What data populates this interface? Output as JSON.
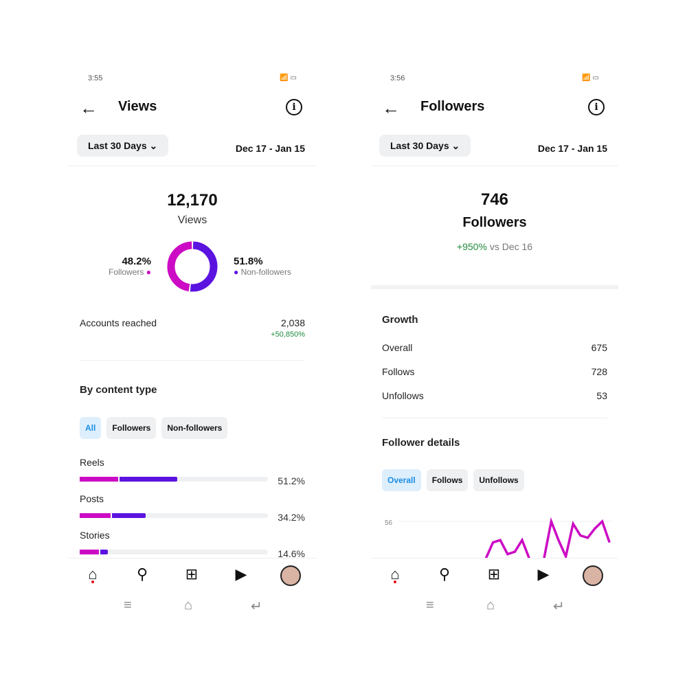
{
  "left": {
    "status_time": "3:55",
    "title": "Views",
    "range": "Last 30 Days",
    "dates": "Dec 17 - Jan 15",
    "total": "12,170",
    "total_label": "Views",
    "followers_pct": "48.2%",
    "followers_label": "Followers",
    "followers_value": 48.2,
    "nonfollowers_pct": "51.8%",
    "nonfollowers_label": "Non-followers",
    "nonfollowers_value": 51.8,
    "accounts_label": "Accounts reached",
    "accounts_value": "2,038",
    "accounts_change": "+50,850%",
    "section": "By content type",
    "filters": [
      "All",
      "Followers",
      "Non-followers"
    ],
    "content": [
      {
        "label": "Reels",
        "pct": "51.2%",
        "followers": 0.21,
        "total": 0.52
      },
      {
        "label": "Posts",
        "pct": "34.2%",
        "followers": 0.17,
        "total": 0.35
      },
      {
        "label": "Stories",
        "pct": "14.6%",
        "followers": 0.11,
        "total": 0.15
      }
    ]
  },
  "right": {
    "status_time": "3:56",
    "title": "Followers",
    "range": "Last 30 Days",
    "dates": "Dec 17 - Jan 15",
    "total": "746",
    "total_label": "Followers",
    "change": "+950%",
    "change_suffix": "vs Dec 16",
    "growth_title": "Growth",
    "growth": [
      {
        "label": "Overall",
        "value": "675"
      },
      {
        "label": "Follows",
        "value": "728"
      },
      {
        "label": "Unfollows",
        "value": "53"
      }
    ],
    "details_title": "Follower details",
    "filters": [
      "Overall",
      "Follows",
      "Unfollows"
    ]
  },
  "colors": {
    "followers": "#cc0bc4",
    "nonfollowers": "#5b13e0",
    "positive": "#1e8a3c",
    "accent": "#1a8fe3"
  },
  "chart_data": {
    "type": "line",
    "y_tick_labels": [
      "56"
    ],
    "series": [
      {
        "values": [
          40,
          47,
          48,
          42,
          43,
          48,
          40,
          null,
          40,
          56,
          48,
          41,
          55,
          50,
          49,
          53,
          56,
          47
        ]
      }
    ]
  }
}
